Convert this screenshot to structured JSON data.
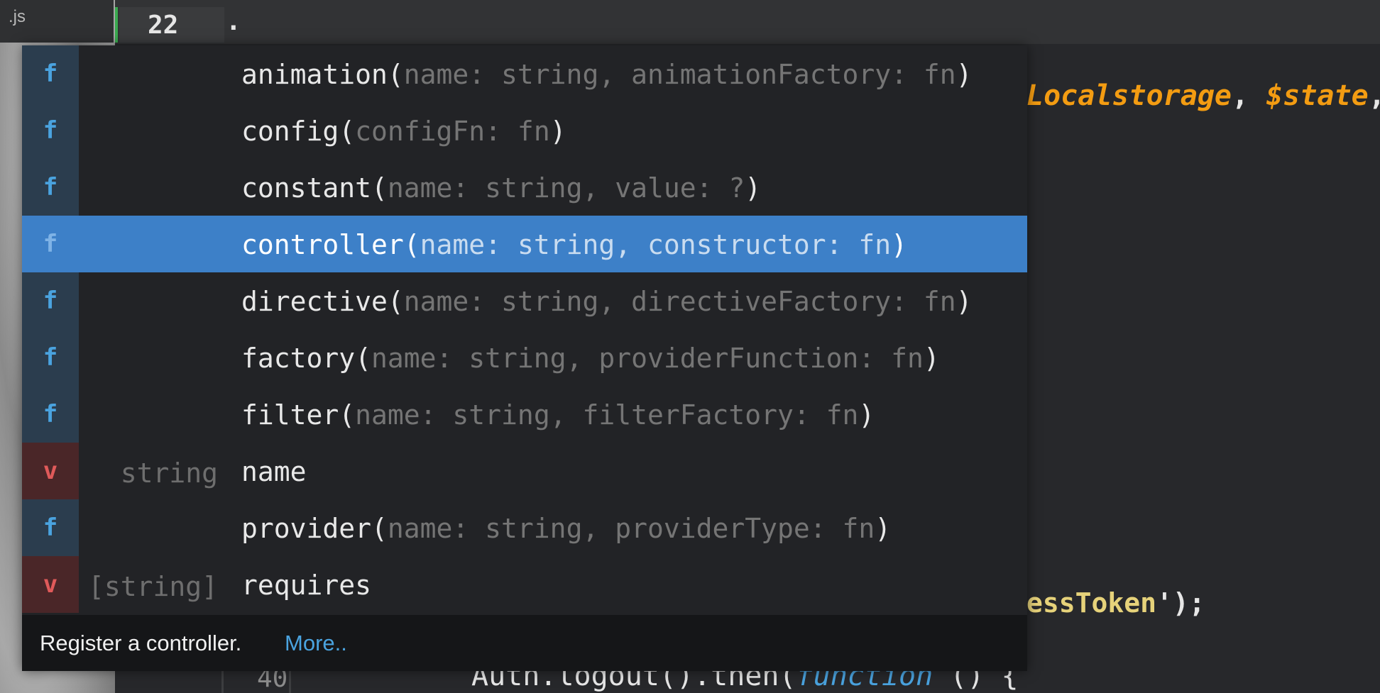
{
  "file_tab": {
    "name": ".js"
  },
  "editor": {
    "active_line_number": "22",
    "active_line_text": ".",
    "code_line_a": {
      "part1": "Localstorage",
      "sep": ", ",
      "part2": "$state",
      "tail": ","
    },
    "code_line_b": {
      "text": "essToken",
      "tail": "');"
    },
    "bottom_line": {
      "number": "40",
      "text": "Auth.logout().then(",
      "keyword": "function",
      "tail": " () {"
    }
  },
  "autocomplete": {
    "items": [
      {
        "kind": "f",
        "type": "",
        "name": "animation(",
        "params": "name: string, animationFactory: fn",
        "close": ")",
        "selected": false
      },
      {
        "kind": "f",
        "type": "",
        "name": "config(",
        "params": "configFn: fn",
        "close": ")",
        "selected": false
      },
      {
        "kind": "f",
        "type": "",
        "name": "constant(",
        "params": "name: string, value: ?",
        "close": ")",
        "selected": false
      },
      {
        "kind": "f",
        "type": "",
        "name": "controller(",
        "params": "name: string, constructor: fn",
        "close": ")",
        "selected": true
      },
      {
        "kind": "f",
        "type": "",
        "name": "directive(",
        "params": "name: string, directiveFactory: fn",
        "close": ")",
        "selected": false
      },
      {
        "kind": "f",
        "type": "",
        "name": "factory(",
        "params": "name: string, providerFunction: fn",
        "close": ")",
        "selected": false
      },
      {
        "kind": "f",
        "type": "",
        "name": "filter(",
        "params": "name: string, filterFactory: fn",
        "close": ")",
        "selected": false
      },
      {
        "kind": "v",
        "type": "string",
        "name": "name",
        "params": "",
        "close": "",
        "selected": false
      },
      {
        "kind": "f",
        "type": "",
        "name": "provider(",
        "params": "name: string, providerType: fn",
        "close": ")",
        "selected": false
      },
      {
        "kind": "v",
        "type": "[string]",
        "name": "requires",
        "params": "",
        "close": "",
        "selected": false
      }
    ],
    "doc": {
      "text": "Register a controller.",
      "more_link": "More.."
    }
  },
  "colors": {
    "selection": "#3d80c8",
    "function_kind": "#4aa3df",
    "variable_kind": "#e05a5a",
    "orange": "#f39c12"
  }
}
